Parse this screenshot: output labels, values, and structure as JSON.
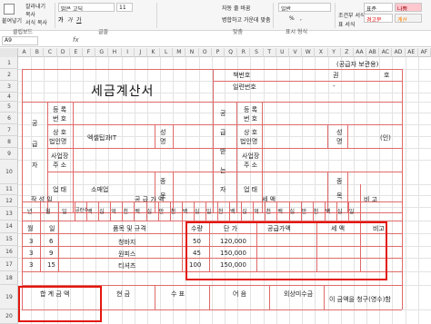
{
  "ribbon": {
    "clipboard": {
      "paste": "붙여넣기",
      "cut": "잘라내기",
      "copy": "복사",
      "format_painter": "서식 복사",
      "group_label": "클립보드"
    },
    "font": {
      "name": "맑은 고딕",
      "size": "11",
      "bold": "가",
      "italic": "가",
      "underline": "가",
      "group_label": "글꼴"
    },
    "alignment": {
      "wrap_text": "자동 줄 바꿈",
      "merge_center": "병합하고 가운데 맞춤",
      "group_label": "맞춤"
    },
    "number": {
      "format": "일반",
      "percent": "%",
      "comma": ",",
      "group_label": "표시 형식"
    },
    "styles": {
      "conditional": "조건부 서식",
      "table": "표 서식",
      "style_normal": "표준",
      "style_bad": "나쁨",
      "style_warning": "경고문",
      "style_calc": "계산"
    }
  },
  "formula_bar": {
    "name_box": "A9",
    "fx": "fx",
    "value": ""
  },
  "columns": [
    "A",
    "B",
    "C",
    "D",
    "E",
    "F",
    "G",
    "H",
    "I",
    "J",
    "K",
    "L",
    "M",
    "N",
    "O",
    "P",
    "Q",
    "R",
    "S",
    "T",
    "U",
    "V",
    "W",
    "X",
    "Y",
    "Z",
    "AA",
    "AB",
    "AC",
    "AD",
    "AE",
    "AF"
  ],
  "rows": [
    "1",
    "2",
    "3",
    "4",
    "5",
    "6",
    "7",
    "8",
    "9",
    "10",
    "11",
    "12",
    "13",
    "14",
    "15",
    "16",
    "17",
    "18",
    "19",
    "20"
  ],
  "invoice": {
    "copy_note": "(공급자 보관용)",
    "title": "세금계산서",
    "book_number": "책번호",
    "volume": "권",
    "number_label": "호",
    "serial_number": "일련번호",
    "serial_dash": "-",
    "supplier_label": [
      "공",
      "급",
      "자"
    ],
    "receiver_label": [
      "공",
      "급",
      "받",
      "는",
      "자"
    ],
    "reg_no": [
      "등 록",
      "번 호"
    ],
    "company": [
      "상 호",
      "법인명"
    ],
    "address": [
      "사업장",
      "주 소"
    ],
    "business_type": "업 태",
    "item": "종",
    "item2": "목",
    "name_label": "성",
    "name_label2": "명",
    "seal": "(인)",
    "supplier_company": "엑셀팁과IT",
    "business_value": "소매업",
    "write_date": "작 성 일",
    "supply_amount": "공 급 가 액",
    "tax": "세 액",
    "remarks": "비 고",
    "date_cols": [
      "년",
      "월",
      "일"
    ],
    "digit_cols": [
      "공란수",
      "백",
      "십",
      "억",
      "천",
      "백",
      "십",
      "만",
      "천",
      "백",
      "십",
      "일",
      "천",
      "백",
      "십",
      "억",
      "천",
      "백",
      "십",
      "만",
      "천",
      "백",
      "십",
      "일"
    ],
    "item_headers": {
      "month": "월",
      "day": "일",
      "item_spec": "품목 및 규격",
      "qty": "수량",
      "unit_price": "단 가",
      "supply_amount": "공급가액",
      "tax": "세 액",
      "remarks": "비고"
    },
    "items": [
      {
        "month": "3",
        "day": "6",
        "name": "청바지",
        "qty": "50",
        "price": "120,000"
      },
      {
        "month": "3",
        "day": "9",
        "name": "원피스",
        "qty": "45",
        "price": "150,000"
      },
      {
        "month": "3",
        "day": "15",
        "name": "티셔츠",
        "qty": "100",
        "price": "150,000"
      }
    ],
    "footer": {
      "total": "합 계 금 액",
      "cash": "현 금",
      "check": "수 표",
      "note": "어 음",
      "credit": "외상미수금",
      "claim": "이 금액을 청구(영수)함"
    }
  }
}
